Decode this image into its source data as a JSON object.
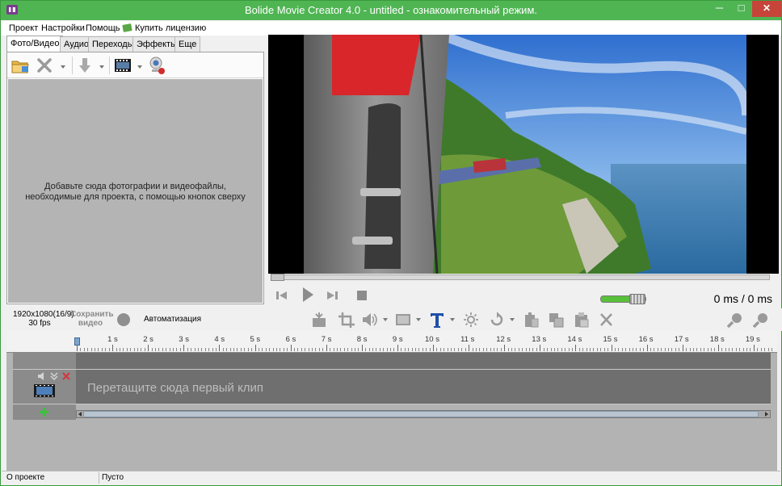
{
  "window": {
    "title": "Bolide Movie Creator 4.0 - untitled  - ознакомительный режим.",
    "minimize": "─",
    "maximize": "□",
    "close": "✕"
  },
  "menu": {
    "items": [
      "Проект",
      "Настройки",
      "Помощь",
      "Купить лицензию"
    ]
  },
  "tabs": [
    "Фото/Видео",
    "Аудио",
    "Переходы",
    "Эффекты",
    "Еще"
  ],
  "media_panel": {
    "empty_text": "Добавьте сюда фотографии и видеофайлы, необходимые для проекта, с помощью кнопок сверху",
    "toolbar_icons": [
      "open-folder-icon",
      "delete-icon",
      "move-down-icon",
      "film-icon",
      "webcam-icon"
    ]
  },
  "player": {
    "time": "0 ms / 0 ms",
    "volume_fraction": 0.68,
    "icons": [
      "step-back-icon",
      "play-icon",
      "step-forward-icon",
      "stop-icon"
    ]
  },
  "project_bar": {
    "resolution": "1920x1080(16/9)",
    "fps": "30 fps",
    "save_video_line1": "Сохранить",
    "save_video_line2": "видео",
    "automation": "Автоматизация"
  },
  "edit_tools": [
    "split-icon",
    "crop-icon",
    "volume-icon",
    "filter-icon",
    "text-icon",
    "brightness-icon",
    "rotate-icon",
    "copy-icon",
    "paste-icon",
    "clipboard-icon",
    "remove-icon",
    "zoom-in-icon",
    "zoom-out-icon"
  ],
  "timeline": {
    "ruler_labels": [
      "1 s",
      "2 s",
      "3 s",
      "4 s",
      "5 s",
      "6 s",
      "7 s",
      "8 s",
      "9 s",
      "10 s",
      "11 s",
      "12 s",
      "13 s",
      "14 s",
      "15 s",
      "16 s",
      "17 s",
      "18 s",
      "19 s"
    ],
    "drop_text": "Перетащите сюда первый клип"
  },
  "status": {
    "left": "О проекте",
    "right": "Пусто"
  },
  "colors": {
    "title_bar": "#4fb553",
    "close_button": "#c7443a",
    "accent_blue": "#1f4fa8"
  }
}
